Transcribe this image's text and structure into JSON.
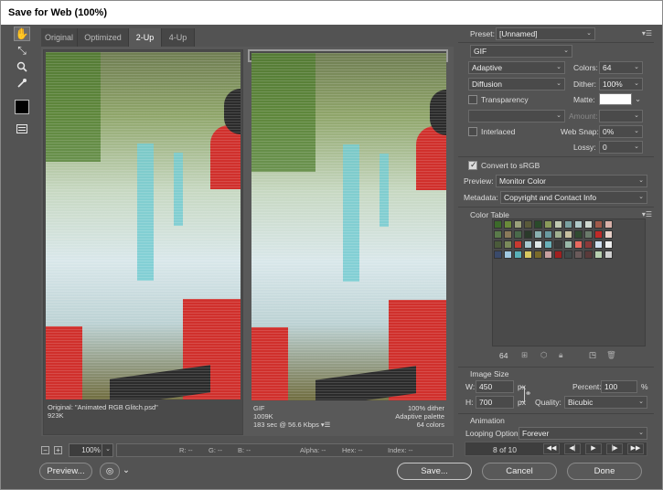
{
  "window": {
    "title": "Save for Web (100%)"
  },
  "tools": [
    {
      "icon": "hand-icon",
      "glyph": "✋"
    },
    {
      "icon": "slice-select-icon",
      "glyph": "⤡"
    },
    {
      "icon": "zoom-icon",
      "glyph": "⚲"
    },
    {
      "icon": "eyedropper-icon",
      "glyph": "✎"
    },
    {
      "icon": "eyedropper-color-icon",
      "glyph": ""
    },
    {
      "icon": "toggle-slices-icon",
      "glyph": "▤"
    }
  ],
  "tabs": [
    "Original",
    "Optimized",
    "2-Up",
    "4-Up"
  ],
  "active_tab": "2-Up",
  "panes": {
    "left": {
      "line1": "Original: \"Animated RGB Glitch.psd\"",
      "line2": "923K"
    },
    "right": {
      "format": "GIF",
      "size": "1009K",
      "time": "183 sec @ 56.6 Kbps",
      "dither": "100% dither",
      "palette": "Adaptive palette",
      "colors": "64 colors"
    }
  },
  "statusbar": {
    "zoom": "100%",
    "r": "R: --",
    "g": "G: --",
    "b": "B: --",
    "alpha": "Alpha: --",
    "hex": "Hex: --",
    "index": "Index: --"
  },
  "buttons": {
    "preview": "Preview...",
    "save": "Save...",
    "cancel": "Cancel",
    "done": "Done"
  },
  "settings": {
    "preset_label": "Preset:",
    "preset_value": "[Unnamed]",
    "format": "GIF",
    "reduction": "Adaptive",
    "colors_label": "Colors:",
    "colors_value": "64",
    "dither_algo": "Diffusion",
    "dither_label": "Dither:",
    "dither_value": "100%",
    "transparency": "Transparency",
    "matte_label": "Matte:",
    "amount_label": "Amount:",
    "interlaced": "Interlaced",
    "websnap_label": "Web Snap:",
    "websnap_value": "0%",
    "lossy_label": "Lossy:",
    "lossy_value": "0",
    "convert_srgb": "Convert to sRGB",
    "preview_label": "Preview:",
    "preview_value": "Monitor Color",
    "metadata_label": "Metadata:",
    "metadata_value": "Copyright and Contact Info"
  },
  "color_table": {
    "title": "Color Table",
    "count": "64",
    "swatches": [
      "#3c6a2a",
      "#6a8a3a",
      "#9aa07a",
      "#5a5a3a",
      "#2a4a2a",
      "#8a9a5a",
      "#c0c8b0",
      "#7aa0a0",
      "#b0c8c8",
      "#d0d8d0",
      "#a05a4a",
      "#d8b0a8",
      "#5a7a4a",
      "#8a7a5a",
      "#4a6a4a",
      "#2a3a2a",
      "#8ab0b0",
      "#6a9aa0",
      "#a0b090",
      "#c8c0a0",
      "#304a30",
      "#6a7a6a",
      "#c02a28",
      "#e8d0c8",
      "#4a5a3a",
      "#7a8a5a",
      "#c83a30",
      "#a8c8d0",
      "#e0e8e8",
      "#6ab0b8",
      "#3a3a3a",
      "#9ab8a8",
      "#e86a60",
      "#8a3a3a",
      "#d0e0f0",
      "#f0f0f0",
      "#3a4a6a",
      "#a0c8e0",
      "#58b0b8",
      "#d8c860",
      "#7a6a2a",
      "#c8a0a0",
      "#a02020",
      "#404a4a",
      "#6a5a5a",
      "#5a3a3a",
      "#b8d0b0",
      "#d0d0d0"
    ]
  },
  "image_size": {
    "title": "Image Size",
    "w_label": "W:",
    "w_value": "450",
    "h_label": "H:",
    "h_value": "700",
    "unit": "px",
    "percent_label": "Percent:",
    "percent_value": "100",
    "percent_unit": "%",
    "quality_label": "Quality:",
    "quality_value": "Bicubic"
  },
  "animation": {
    "title": "Animation",
    "looping_label": "Looping Options:",
    "looping_value": "Forever",
    "frame": "8 of 10"
  }
}
